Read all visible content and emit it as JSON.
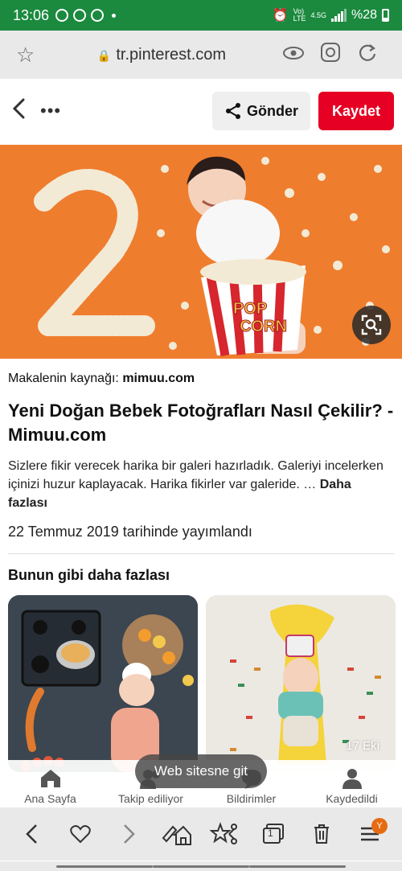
{
  "status_bar": {
    "time": "13:06",
    "signal_label_top": "Vo)",
    "signal_label_bottom": "LTE",
    "network": "4.5G",
    "battery": "%28"
  },
  "url_bar": {
    "url": "tr.pinterest.com"
  },
  "header": {
    "share_label": "Gönder",
    "save_label": "Kaydet"
  },
  "pin": {
    "source_prefix": "Makalenin kaynağı:",
    "source_domain": "mimuu.com",
    "title": "Yeni Doğan Bebek Fotoğrafları Nasıl Çekilir? - Mimuu.com",
    "description": "Sizlere fikir verecek harika bir galeri hazırladık. Galeriyi incelerken içinizi huzur kaplayacak. Harika fikirler var galeride. …",
    "more_label": "Daha fazlası",
    "published": "22 Temmuz 2019 tarihinde yayımlandı",
    "hero_popcorn_text": "POP CORN",
    "hero_number": "2"
  },
  "more_like_this": {
    "heading": "Bunun gibi daha fazlası",
    "cards": [
      {
        "tag": ""
      },
      {
        "tag": "17 Eki"
      }
    ]
  },
  "web_button": "Web sitesne git",
  "bottom_nav": [
    {
      "label": "Ana Sayfa",
      "icon": "home-icon"
    },
    {
      "label": "Takip ediliyor",
      "icon": "following-icon"
    },
    {
      "label": "Bildirimler",
      "icon": "chat-icon"
    },
    {
      "label": "Kaydedildi",
      "icon": "profile-icon"
    }
  ],
  "browser_bar": {
    "tabs_count": "1",
    "profile_badge": "Y"
  },
  "colors": {
    "status_green": "#1b8a3f",
    "pinterest_red": "#e60023",
    "hero_orange": "#ef7d2e"
  }
}
